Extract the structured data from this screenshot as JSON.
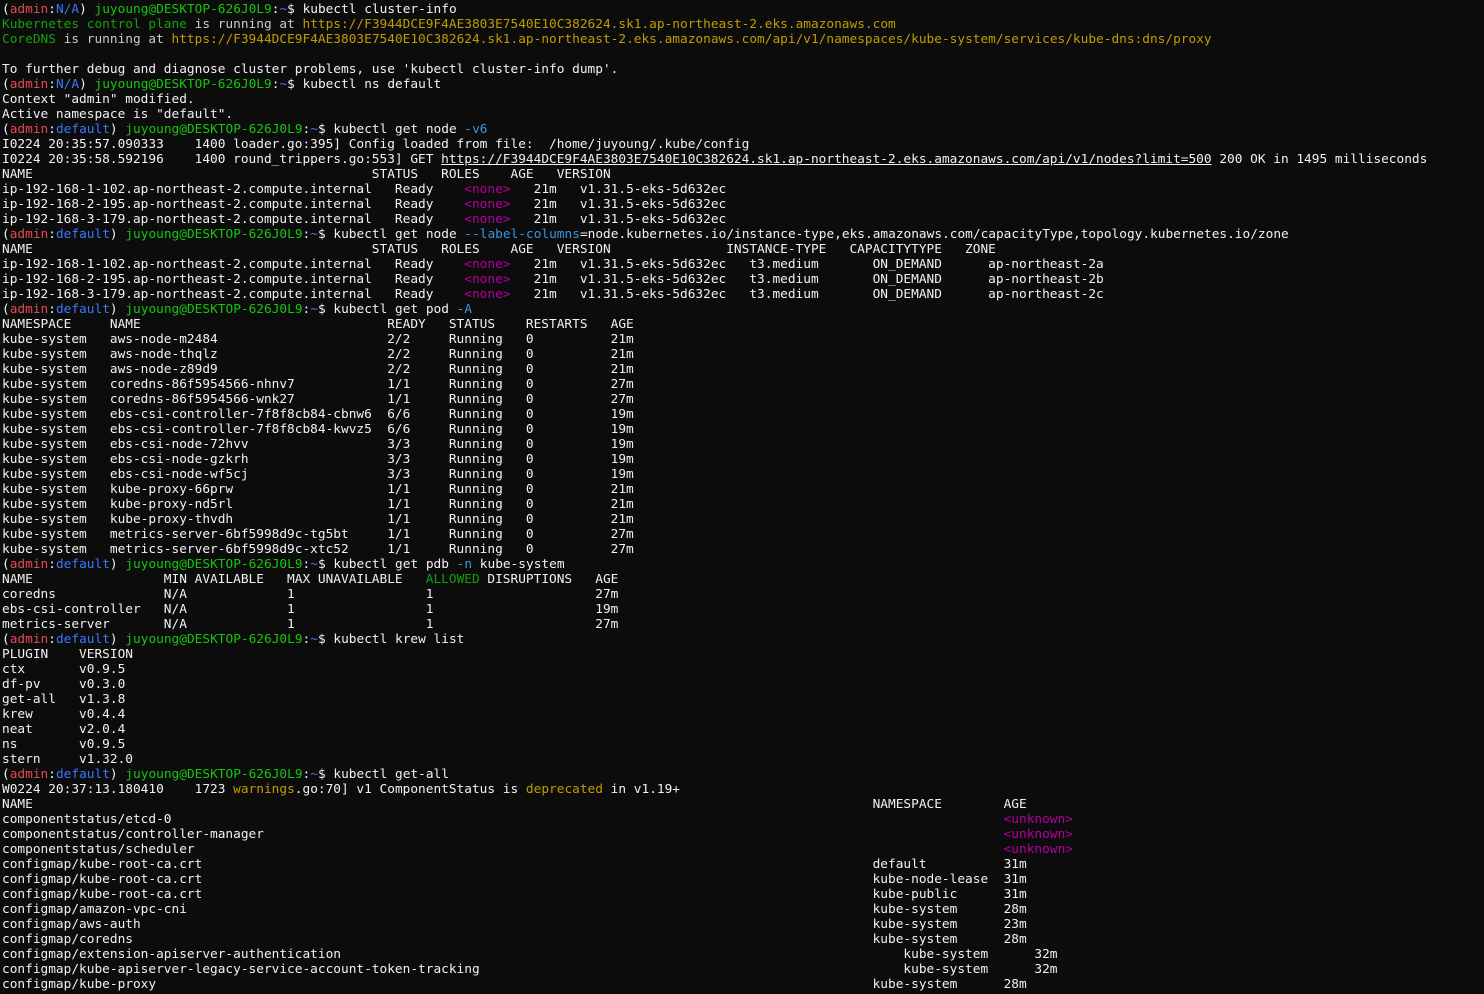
{
  "terminal": {
    "colors": {
      "background": "#0c0c0c",
      "text": "#cccccc",
      "prompt_user": "#e74856",
      "prompt_ns": "#3b78ff",
      "prompt_host": "#16c60c",
      "url_yellow": "#c19c00",
      "link_yellow": "#f9f1a5"
    },
    "lines": [
      [
        [
          "c-white",
          "("
        ],
        [
          "c-red",
          "admin"
        ],
        [
          "c-white",
          ":"
        ],
        [
          "c-blue",
          "N/A"
        ],
        [
          "c-white",
          ") "
        ],
        [
          "c-green",
          "juyoung@DESKTOP-626J0L9"
        ],
        [
          "c-white",
          ":"
        ],
        [
          "c-blue",
          "~"
        ],
        [
          "c-white",
          "$ kubectl cluster-info"
        ]
      ],
      [
        [
          "c-green2",
          "Kubernetes control plane"
        ],
        [
          "c-default",
          " is running at "
        ],
        [
          "c-yellow2",
          "https://F3944DCE9F4AE3803E7540E10C382624.sk1.ap-northeast-2.eks.amazonaws.com"
        ]
      ],
      [
        [
          "c-green2",
          "CoreDNS"
        ],
        [
          "c-default",
          " is running at "
        ],
        [
          "c-yellow2",
          "https://F3944DCE9F4AE3803E7540E10C382624.sk1.ap-northeast-2.eks.amazonaws.com/api/v1/namespaces/kube-system/services/kube-dns:dns/proxy"
        ]
      ],
      [
        [
          "c-default",
          ""
        ]
      ],
      [
        [
          "c-white",
          "To further debug and diagnose cluster problems, use 'kubectl cluster-info dump'."
        ]
      ],
      [
        [
          "c-white",
          "("
        ],
        [
          "c-red",
          "admin"
        ],
        [
          "c-white",
          ":"
        ],
        [
          "c-blue",
          "N/A"
        ],
        [
          "c-white",
          ") "
        ],
        [
          "c-green",
          "juyoung@DESKTOP-626J0L9"
        ],
        [
          "c-white",
          ":"
        ],
        [
          "c-blue",
          "~"
        ],
        [
          "c-white",
          "$ kubectl ns default"
        ]
      ],
      [
        [
          "c-white",
          "Context \"admin\" modified."
        ]
      ],
      [
        [
          "c-white",
          "Active namespace is \"default\"."
        ]
      ],
      [
        [
          "c-white",
          "("
        ],
        [
          "c-red",
          "admin"
        ],
        [
          "c-white",
          ":"
        ],
        [
          "c-blue",
          "default"
        ],
        [
          "c-white",
          ") "
        ],
        [
          "c-green",
          "juyoung@DESKTOP-626J0L9"
        ],
        [
          "c-white",
          ":"
        ],
        [
          "c-blue",
          "~"
        ],
        [
          "c-white",
          "$ kubectl get node "
        ],
        [
          "c-cyan",
          "-v6"
        ]
      ],
      [
        [
          "c-white",
          "I0224 20:35:57.090333    1400 loader.go:395] Config loaded from file:  /home/juyoung/.kube/config"
        ]
      ],
      [
        [
          "c-white",
          "I0224 20:35:58.592196    1400 round_trippers.go:553] GET "
        ],
        [
          "c-white u",
          "https://F3944DCE9F4AE3803E7540E10C382624.sk1.ap-northeast-2.eks.amazonaws.com/api/v1/nodes?limit=500"
        ],
        [
          "c-white",
          " 200 OK in 1495 milliseconds"
        ]
      ],
      [
        [
          "c-white",
          "NAME                                            STATUS   ROLES    AGE   VERSION"
        ]
      ],
      [
        [
          "c-white",
          "ip-192-168-1-102.ap-northeast-2.compute.internal   Ready    "
        ],
        [
          "c-magenta",
          "<none>"
        ],
        [
          "c-white",
          "   21m   v1.31.5-eks-5d632ec"
        ]
      ],
      [
        [
          "c-white",
          "ip-192-168-2-195.ap-northeast-2.compute.internal   Ready    "
        ],
        [
          "c-magenta",
          "<none>"
        ],
        [
          "c-white",
          "   21m   v1.31.5-eks-5d632ec"
        ]
      ],
      [
        [
          "c-white",
          "ip-192-168-3-179.ap-northeast-2.compute.internal   Ready    "
        ],
        [
          "c-magenta",
          "<none>"
        ],
        [
          "c-white",
          "   21m   v1.31.5-eks-5d632ec"
        ]
      ],
      [
        [
          "c-white",
          "("
        ],
        [
          "c-red",
          "admin"
        ],
        [
          "c-white",
          ":"
        ],
        [
          "c-blue",
          "default"
        ],
        [
          "c-white",
          ") "
        ],
        [
          "c-green",
          "juyoung@DESKTOP-626J0L9"
        ],
        [
          "c-white",
          ":"
        ],
        [
          "c-blue",
          "~"
        ],
        [
          "c-white",
          "$ kubectl get node "
        ],
        [
          "c-cyan",
          "--label-columns"
        ],
        [
          "c-white",
          "=node.kubernetes.io/instance-type,eks.amazonaws.com/capacityType,topology.kubernetes.io/zone"
        ]
      ],
      [
        [
          "c-white",
          "NAME                                            STATUS   ROLES    AGE   VERSION               INSTANCE-TYPE   CAPACITYTYPE   ZONE"
        ]
      ],
      [
        [
          "c-white",
          "ip-192-168-1-102.ap-northeast-2.compute.internal   Ready    "
        ],
        [
          "c-magenta",
          "<none>"
        ],
        [
          "c-white",
          "   21m   v1.31.5-eks-5d632ec   t3.medium       ON_DEMAND      ap-northeast-2a"
        ]
      ],
      [
        [
          "c-white",
          "ip-192-168-2-195.ap-northeast-2.compute.internal   Ready    "
        ],
        [
          "c-magenta",
          "<none>"
        ],
        [
          "c-white",
          "   21m   v1.31.5-eks-5d632ec   t3.medium       ON_DEMAND      ap-northeast-2b"
        ]
      ],
      [
        [
          "c-white",
          "ip-192-168-3-179.ap-northeast-2.compute.internal   Ready    "
        ],
        [
          "c-magenta",
          "<none>"
        ],
        [
          "c-white",
          "   21m   v1.31.5-eks-5d632ec   t3.medium       ON_DEMAND      ap-northeast-2c"
        ]
      ],
      [
        [
          "c-white",
          "("
        ],
        [
          "c-red",
          "admin"
        ],
        [
          "c-white",
          ":"
        ],
        [
          "c-blue",
          "default"
        ],
        [
          "c-white",
          ") "
        ],
        [
          "c-green",
          "juyoung@DESKTOP-626J0L9"
        ],
        [
          "c-white",
          ":"
        ],
        [
          "c-blue",
          "~"
        ],
        [
          "c-white",
          "$ kubectl get pod "
        ],
        [
          "c-cyan",
          "-A"
        ]
      ],
      [
        [
          "c-white",
          "NAMESPACE     NAME                                READY   STATUS    RESTARTS   AGE"
        ]
      ],
      [
        [
          "c-white",
          "kube-system   aws-node-m2484                      2/2     Running   0          21m"
        ]
      ],
      [
        [
          "c-white",
          "kube-system   aws-node-thqlz                      2/2     Running   0          21m"
        ]
      ],
      [
        [
          "c-white",
          "kube-system   aws-node-z89d9                      2/2     Running   0          21m"
        ]
      ],
      [
        [
          "c-white",
          "kube-system   coredns-86f5954566-nhnv7            1/1     Running   0          27m"
        ]
      ],
      [
        [
          "c-white",
          "kube-system   coredns-86f5954566-wnk27            1/1     Running   0          27m"
        ]
      ],
      [
        [
          "c-white",
          "kube-system   ebs-csi-controller-7f8f8cb84-cbnw6  6/6     Running   0          19m"
        ]
      ],
      [
        [
          "c-white",
          "kube-system   ebs-csi-controller-7f8f8cb84-kwvz5  6/6     Running   0          19m"
        ]
      ],
      [
        [
          "c-white",
          "kube-system   ebs-csi-node-72hvv                  3/3     Running   0          19m"
        ]
      ],
      [
        [
          "c-white",
          "kube-system   ebs-csi-node-gzkrh                  3/3     Running   0          19m"
        ]
      ],
      [
        [
          "c-white",
          "kube-system   ebs-csi-node-wf5cj                  3/3     Running   0          19m"
        ]
      ],
      [
        [
          "c-white",
          "kube-system   kube-proxy-66prw                    1/1     Running   0          21m"
        ]
      ],
      [
        [
          "c-white",
          "kube-system   kube-proxy-nd5rl                    1/1     Running   0          21m"
        ]
      ],
      [
        [
          "c-white",
          "kube-system   kube-proxy-thvdh                    1/1     Running   0          21m"
        ]
      ],
      [
        [
          "c-white",
          "kube-system   metrics-server-6bf5998d9c-tg5bt     1/1     Running   0          27m"
        ]
      ],
      [
        [
          "c-white",
          "kube-system   metrics-server-6bf5998d9c-xtc52     1/1     Running   0          27m"
        ]
      ],
      [
        [
          "c-white",
          "("
        ],
        [
          "c-red",
          "admin"
        ],
        [
          "c-white",
          ":"
        ],
        [
          "c-blue",
          "default"
        ],
        [
          "c-white",
          ") "
        ],
        [
          "c-green",
          "juyoung@DESKTOP-626J0L9"
        ],
        [
          "c-white",
          ":"
        ],
        [
          "c-blue",
          "~"
        ],
        [
          "c-white",
          "$ kubectl get pdb "
        ],
        [
          "c-cyan",
          "-n"
        ],
        [
          "c-white",
          " kube-system"
        ]
      ],
      [
        [
          "c-white",
          "NAME                 MIN AVAILABLE   MAX UNAVAILABLE   "
        ],
        [
          "c-green2",
          "ALLOWED"
        ],
        [
          "c-white",
          " DISRUPTIONS   AGE"
        ]
      ],
      [
        [
          "c-white",
          "coredns              N/A             1                 1                     27m"
        ]
      ],
      [
        [
          "c-white",
          "ebs-csi-controller   N/A             1                 1                     19m"
        ]
      ],
      [
        [
          "c-white",
          "metrics-server       N/A             1                 1                     27m"
        ]
      ],
      [
        [
          "c-white",
          "("
        ],
        [
          "c-red",
          "admin"
        ],
        [
          "c-white",
          ":"
        ],
        [
          "c-blue",
          "default"
        ],
        [
          "c-white",
          ") "
        ],
        [
          "c-green",
          "juyoung@DESKTOP-626J0L9"
        ],
        [
          "c-white",
          ":"
        ],
        [
          "c-blue",
          "~"
        ],
        [
          "c-white",
          "$ kubectl krew list"
        ]
      ],
      [
        [
          "c-white",
          "PLUGIN    VERSION"
        ]
      ],
      [
        [
          "c-white",
          "ctx       v0.9.5"
        ]
      ],
      [
        [
          "c-white",
          "df-pv     v0.3.0"
        ]
      ],
      [
        [
          "c-white",
          "get-all   v1.3.8"
        ]
      ],
      [
        [
          "c-white",
          "krew      v0.4.4"
        ]
      ],
      [
        [
          "c-white",
          "neat      v2.0.4"
        ]
      ],
      [
        [
          "c-white",
          "ns        v0.9.5"
        ]
      ],
      [
        [
          "c-white",
          "stern     v1.32.0"
        ]
      ],
      [
        [
          "c-white",
          "("
        ],
        [
          "c-red",
          "admin"
        ],
        [
          "c-white",
          ":"
        ],
        [
          "c-blue",
          "default"
        ],
        [
          "c-white",
          ") "
        ],
        [
          "c-green",
          "juyoung@DESKTOP-626J0L9"
        ],
        [
          "c-white",
          ":"
        ],
        [
          "c-blue",
          "~"
        ],
        [
          "c-white",
          "$ kubectl get-all"
        ]
      ],
      [
        [
          "c-white",
          "W0224 20:37:13.180410    1723 "
        ],
        [
          "c-yellow2",
          "warnings"
        ],
        [
          "c-white",
          ".go:70] v1 ComponentStatus is "
        ],
        [
          "c-yellow2",
          "deprecated"
        ],
        [
          "c-white",
          " in v1.19+"
        ]
      ],
      [
        [
          "c-white",
          "NAME                                                                                                             NAMESPACE        AGE"
        ]
      ],
      [
        [
          "c-white",
          "componentstatus/etcd-0                                                                                                            "
        ],
        [
          "c-magenta",
          "<unknown>"
        ]
      ],
      [
        [
          "c-white",
          "componentstatus/controller-manager                                                                                                "
        ],
        [
          "c-magenta",
          "<unknown>"
        ]
      ],
      [
        [
          "c-white",
          "componentstatus/scheduler                                                                                                         "
        ],
        [
          "c-magenta",
          "<unknown>"
        ]
      ],
      [
        [
          "c-white",
          "configmap/kube-root-ca.crt                                                                                       default          31m"
        ]
      ],
      [
        [
          "c-white",
          "configmap/kube-root-ca.crt                                                                                       kube-node-lease  31m"
        ]
      ],
      [
        [
          "c-white",
          "configmap/kube-root-ca.crt                                                                                       kube-public      31m"
        ]
      ],
      [
        [
          "c-white",
          "configmap/amazon-vpc-cni                                                                                         kube-system      28m"
        ]
      ],
      [
        [
          "c-white",
          "configmap/aws-auth                                                                                               kube-system      23m"
        ]
      ],
      [
        [
          "c-white",
          "configmap/coredns                                                                                                kube-system      28m"
        ]
      ],
      [
        [
          "c-white",
          "configmap/extension-apiserver-authentication                                                                         kube-system      32m"
        ]
      ],
      [
        [
          "c-white",
          "configmap/kube-apiserver-legacy-service-account-token-tracking                                                       kube-system      32m"
        ]
      ],
      [
        [
          "c-white",
          "configmap/kube-proxy                                                                                             kube-system      28m"
        ]
      ]
    ]
  }
}
